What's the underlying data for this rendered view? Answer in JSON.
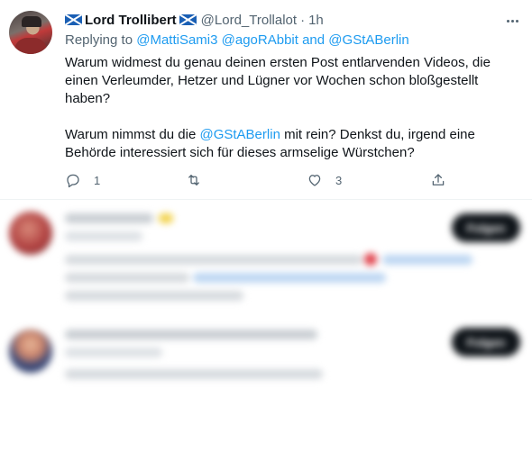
{
  "tweet": {
    "display_name": "Lord Trollibert",
    "handle": "@Lord_Trollalot",
    "separator": "·",
    "time": "1h",
    "reply_prefix": "Replying to",
    "reply_user1": "@MattiSami3",
    "reply_user2": "@agoRAbbit",
    "reply_and": "and",
    "reply_user3": "@GStABerlin",
    "paragraph1": "Warum widmest du genau deinen ersten Post entlarvenden Videos, die einen Verleumder, Hetzer und Lügner vor Wochen schon bloßgestellt haben?",
    "paragraph2_start": "Warum nimmst du die",
    "paragraph2_mention": "@GStABerlin",
    "paragraph2_end": "mit rein? Denkst du, irgend eine Behörde interessiert sich für dieses armselige Würstchen?",
    "reply_count": "1",
    "retweet_count": "",
    "like_count": "3"
  },
  "icons": {
    "flag": "scotland-flag-icon",
    "more": "more-dots-icon",
    "reply": "reply-icon",
    "retweet": "retweet-icon",
    "like": "heart-icon",
    "share": "share-icon"
  },
  "replies_blurred": {
    "follow_label": "Folgen"
  },
  "colors": {
    "link": "#1d9bf0",
    "text": "#0f1419",
    "secondary": "#536471",
    "divider": "#eff3f4"
  }
}
